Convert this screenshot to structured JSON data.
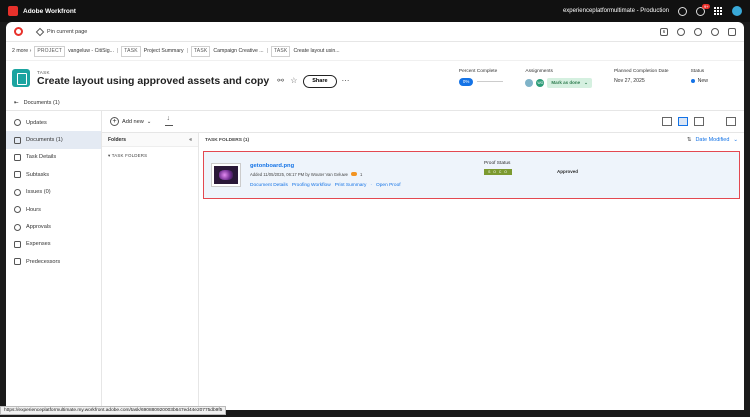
{
  "os": {
    "app_name": "Adobe Workfront",
    "env_label": "experienceplatformultimate - Production",
    "notif_count": "9+"
  },
  "topbar": {
    "pin_label": "Pin current page",
    "count_badge": "6"
  },
  "breadcrumb": {
    "more": "2 more",
    "items": [
      {
        "type": "PROJECT",
        "name": "vangeluw - CitiSig..."
      },
      {
        "type": "TASK",
        "name": "Project Summary"
      },
      {
        "type": "TASK",
        "name": "Campaign Creative ..."
      },
      {
        "type": "TASK",
        "name": "Create layout usin..."
      }
    ]
  },
  "header": {
    "object_type": "TASK",
    "title": "Create layout using approved assets and copy",
    "share_label": "Share",
    "percent_label": "Percent Complete",
    "percent_value": "0%",
    "assignments_label": "Assignments",
    "assignee_initials": [
      "",
      "WG"
    ],
    "mark_done_label": "Mark as done",
    "planned_label": "Planned Completion Date",
    "planned_value": "Nov 27, 2025",
    "status_label": "Status",
    "status_value": "New",
    "status_color": "#1473e6"
  },
  "doc_crumb": {
    "label": "Documents (1)"
  },
  "sidebar": {
    "items": [
      {
        "label": "Updates",
        "icon": "chat-icon"
      },
      {
        "label": "Documents (1)",
        "icon": "document-icon"
      },
      {
        "label": "Task Details",
        "icon": "details-icon"
      },
      {
        "label": "Subtasks",
        "icon": "subtasks-icon"
      },
      {
        "label": "Issues (0)",
        "icon": "issue-icon"
      },
      {
        "label": "Hours",
        "icon": "clock-icon"
      },
      {
        "label": "Approvals",
        "icon": "check-circle-icon"
      },
      {
        "label": "Expenses",
        "icon": "money-icon"
      },
      {
        "label": "Predecessors",
        "icon": "link-icon"
      }
    ]
  },
  "toolbar": {
    "add_new_label": "Add new"
  },
  "folders": {
    "header": "Folders",
    "item": "TASK FOLDERS"
  },
  "files": {
    "header": "TASK FOLDERS (1)",
    "sort_label": "Date Modified",
    "file": {
      "name": "getonboard.png",
      "meta": "Added 11/05/2025, 06:17 PM by Wouter Van Geluwe",
      "comment_count": "1",
      "links": [
        "Document Details",
        "Proofing Workflow",
        "Print Summary",
        "·",
        "Open Proof"
      ],
      "proof_status_label": "Proof Status",
      "proof_badge": "S O C O",
      "approval": "Approved"
    }
  },
  "status_url": "https://experienceplatformultimate.my.workfront.adobe.com/task/690880920003b647ed44e20775db9f5"
}
